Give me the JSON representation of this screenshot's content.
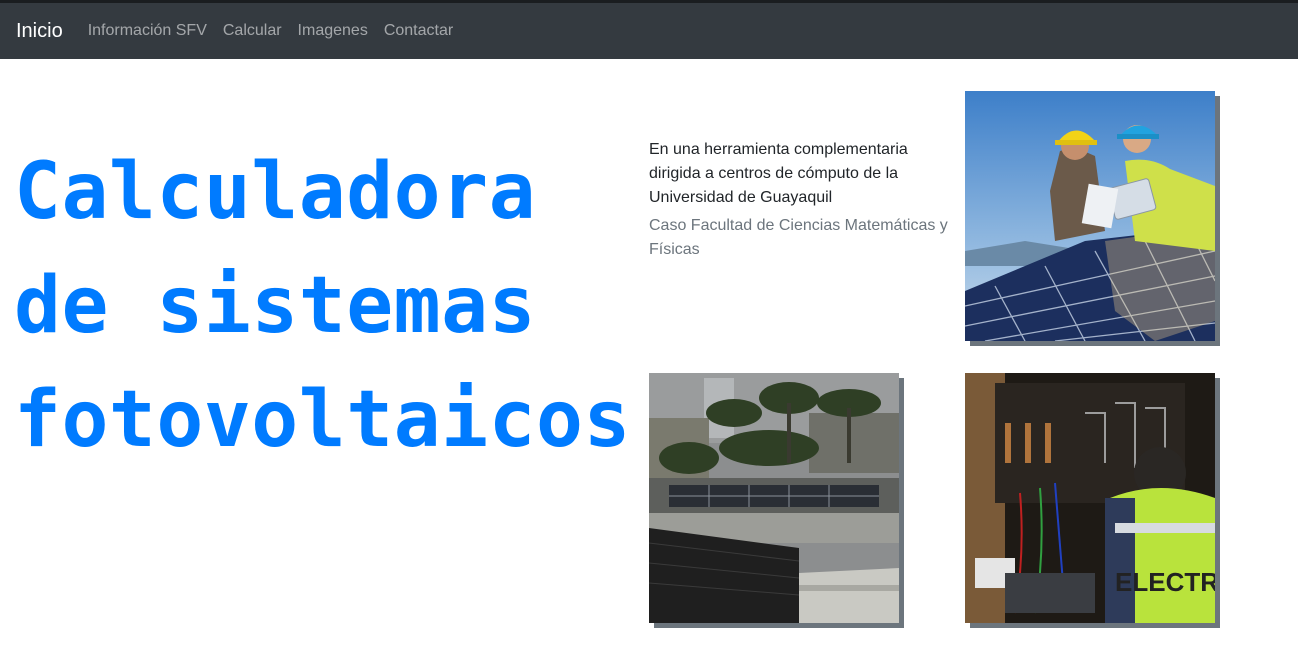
{
  "navbar": {
    "brand": "Inicio",
    "links": [
      "Información SFV",
      "Calcular",
      "Imagenes",
      "Contactar"
    ]
  },
  "hero": {
    "lines": [
      "Calculadora",
      "de sistemas",
      "fotovoltaicos"
    ]
  },
  "intro": {
    "text": "En una herramienta complementaria dirigida a centros de cómputo de la Universidad de Guayaquil",
    "subtext": "Caso Facultad de Ciencias Matemáticas y Físicas"
  },
  "images": {
    "vest_text": "ELECTR"
  },
  "colors": {
    "navbar_bg": "#343a40",
    "accent": "#007bff",
    "muted": "#6c757d"
  }
}
